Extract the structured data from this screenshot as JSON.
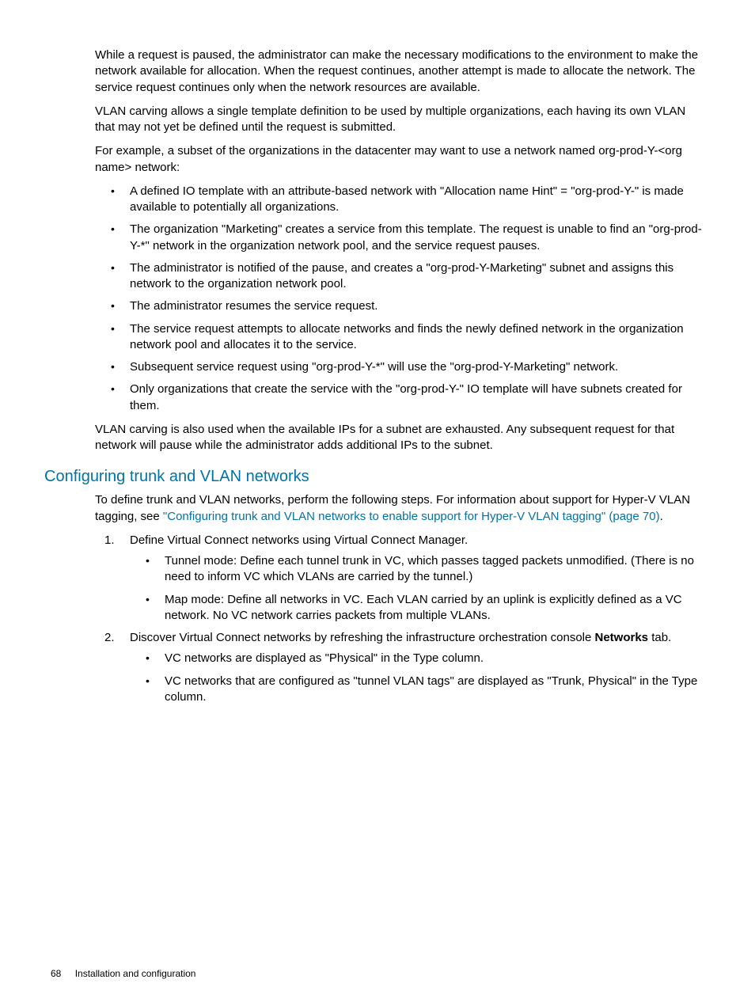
{
  "paragraphs": {
    "p1": "While a request is paused, the administrator can make the necessary modifications to the environment to make the network available for allocation. When the request continues, another attempt is made to allocate the network. The service request continues only when the network resources are available.",
    "p2": "VLAN carving allows a single template definition to be used by multiple organizations, each having its own VLAN that may not yet be defined until the request is submitted.",
    "p3": "For example, a subset of the organizations in the datacenter may want to use a network named org-prod-Y-<org name> network:",
    "p4": "VLAN carving is also used when the available IPs for a subnet are exhausted. Any subsequent request for that network will pause while the administrator adds additional IPs to the subnet."
  },
  "bullets1": [
    "A defined IO template with an attribute-based network with \"Allocation name Hint\" = \"org-prod-Y-\" is made available to potentially all organizations.",
    "The organization \"Marketing\" creates a service from this template. The request is unable to find an \"org-prod-Y-*\" network in the organization network pool, and the service request pauses.",
    "The administrator is notified of the pause, and creates a \"org-prod-Y-Marketing\" subnet and assigns this network to the organization network pool.",
    "The administrator resumes the service request.",
    "The service request attempts to allocate networks and finds the newly defined network in the organization network pool and allocates it to the service.",
    "Subsequent service request using \"org-prod-Y-*\" will use the \"org-prod-Y-Marketing\" network.",
    "Only organizations that create the service with the \"org-prod-Y-\" IO template will have subnets created for them."
  ],
  "heading": "Configuring trunk and VLAN networks",
  "intro": {
    "before_link": "To define trunk and VLAN networks, perform the following steps. For information about support for Hyper-V VLAN tagging, see ",
    "link": "\"Configuring trunk and VLAN networks to enable support for Hyper-V VLAN tagging\" (page 70)",
    "after_link": "."
  },
  "steps": {
    "s1": "Define Virtual Connect networks using Virtual Connect Manager.",
    "s1_sub": [
      "Tunnel mode: Define each tunnel trunk in VC, which passes tagged packets unmodified. (There is no need to inform VC which VLANs are carried by the tunnel.)",
      "Map mode: Define all networks in VC. Each VLAN carried by an uplink is explicitly defined as a VC network. No VC network carries packets from multiple VLANs."
    ],
    "s2_before_bold": "Discover Virtual Connect networks by refreshing the infrastructure orchestration console ",
    "s2_bold": "Networks",
    "s2_after_bold": " tab.",
    "s2_sub": [
      "VC networks are displayed as \"Physical\" in the Type column.",
      "VC networks that are configured as \"tunnel VLAN tags\" are displayed as \"Trunk, Physical\" in the Type column."
    ]
  },
  "footer": {
    "page": "68",
    "title": "Installation and configuration"
  }
}
